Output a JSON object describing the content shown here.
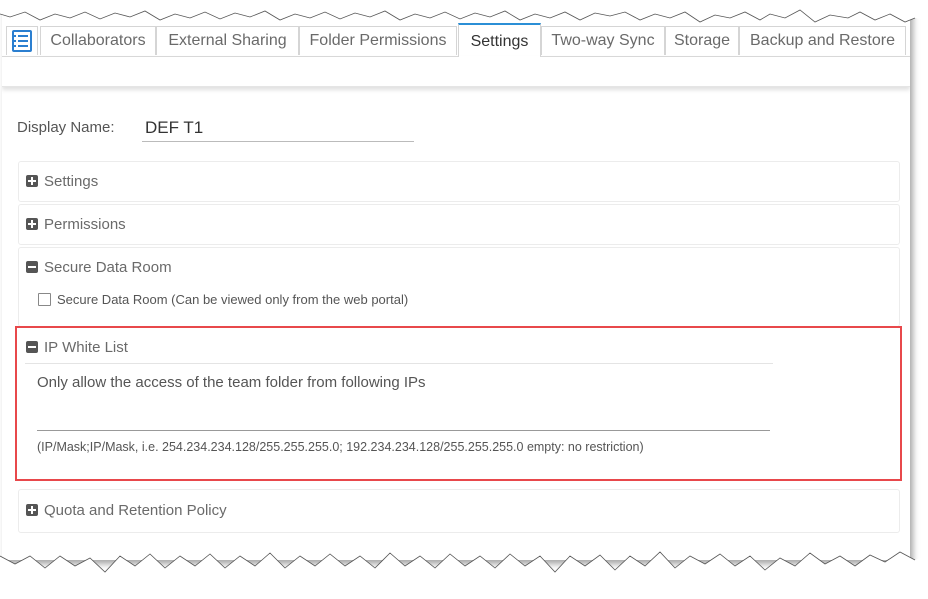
{
  "tabs": [
    {
      "label": "Collaborators"
    },
    {
      "label": "External Sharing"
    },
    {
      "label": "Folder Permissions"
    },
    {
      "label": "Settings"
    },
    {
      "label": "Two-way Sync"
    },
    {
      "label": "Storage"
    },
    {
      "label": "Backup and Restore"
    }
  ],
  "active_tab": "Settings",
  "display_name": {
    "label": "Display Name:",
    "value": "DEF T1"
  },
  "sections": {
    "settings": {
      "title": "Settings",
      "state": "collapsed"
    },
    "permissions": {
      "title": "Permissions",
      "state": "collapsed"
    },
    "secure_data_room": {
      "title": "Secure Data Room",
      "state": "expanded",
      "checkbox_label": "Secure Data Room (Can be viewed only from the web portal)",
      "checked": false
    },
    "ip_white_list": {
      "title": "IP White List",
      "state": "expanded",
      "description": "Only allow the access of the team folder from following IPs",
      "input_value": "",
      "hint": "(IP/Mask;IP/Mask, i.e. 254.234.234.128/255.255.255.0; 192.234.234.128/255.255.255.0 empty: no restriction)"
    },
    "quota": {
      "title": "Quota and Retention Policy",
      "state": "collapsed"
    }
  },
  "colors": {
    "accent": "#2b8fd6",
    "highlight": "#e8484b"
  }
}
